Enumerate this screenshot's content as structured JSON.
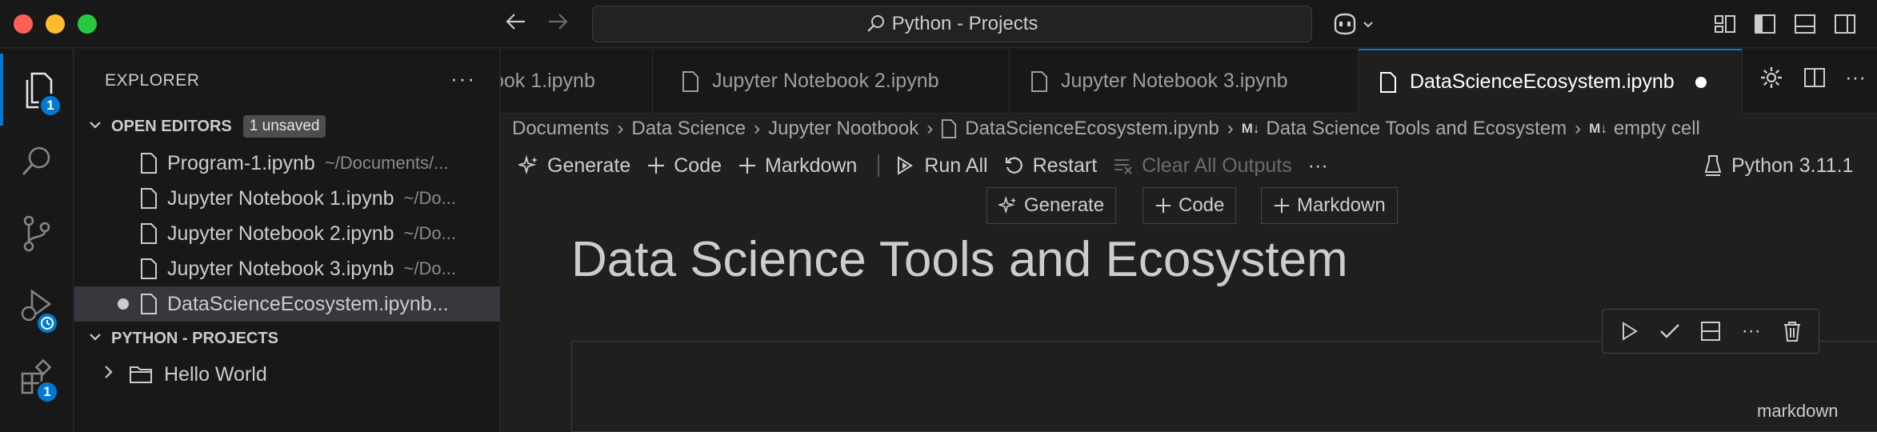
{
  "titlebar": {
    "search_text": "Python - Projects"
  },
  "activity": {
    "explorer_badge": "1",
    "extensions_badge": "1"
  },
  "sidebar": {
    "title": "EXPLORER",
    "more": "···",
    "open_editors": {
      "label": "OPEN EDITORS",
      "unsaved_badge": "1 unsaved",
      "files": [
        {
          "name": "Program-1.ipynb",
          "path": "~/Documents/..."
        },
        {
          "name": "Jupyter Notebook 1.ipynb",
          "path": "~/Do..."
        },
        {
          "name": "Jupyter Notebook 2.ipynb",
          "path": "~/Do..."
        },
        {
          "name": "Jupyter Notebook 3.ipynb",
          "path": "~/Do..."
        },
        {
          "name": "DataScienceEcosystem.ipynb...",
          "path": ""
        }
      ]
    },
    "project": {
      "label": "PYTHON - PROJECTS",
      "folders": [
        {
          "name": "Hello World"
        }
      ]
    }
  },
  "tabs": [
    {
      "label": "ook 1.ipynb"
    },
    {
      "label": "Jupyter Notebook 2.ipynb"
    },
    {
      "label": "Jupyter Notebook 3.ipynb"
    },
    {
      "label": "DataScienceEcosystem.ipynb"
    }
  ],
  "breadcrumb": {
    "items": [
      "Documents",
      "Data Science",
      "Jupyter Nootbook",
      "DataScienceEcosystem.ipynb",
      "Data Science Tools and Ecosystem",
      "empty cell"
    ],
    "md_glyph": "M↓"
  },
  "toolbar": {
    "generate": "Generate",
    "code": "Code",
    "markdown": "Markdown",
    "run_all": "Run All",
    "restart": "Restart",
    "clear_outputs": "Clear All Outputs",
    "more": "···",
    "kernel": "Python 3.11.1"
  },
  "insert_bar": {
    "generate": "Generate",
    "code": "Code",
    "markdown": "Markdown"
  },
  "notebook": {
    "heading": "Data Science Tools and Ecosystem",
    "cell_language": "markdown"
  },
  "colors": {
    "accent": "#0078d4",
    "background": "#1f1f1f",
    "sidebar_bg": "#181818"
  }
}
